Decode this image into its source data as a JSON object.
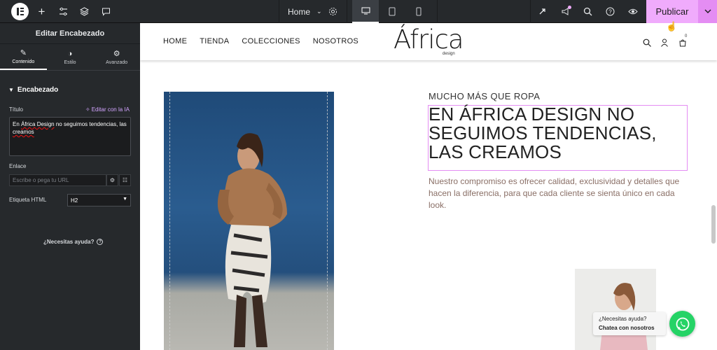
{
  "topbar": {
    "page_name": "Home",
    "publish_label": "Publicar",
    "accent": "#f0abfc"
  },
  "panel": {
    "title": "Editar Encabezado",
    "tabs": [
      "Contenido",
      "Estilo",
      "Avanzado"
    ],
    "section": "Encabezado",
    "title_label": "Título",
    "ai_link": "Editar con la IA",
    "title_value_a": "En ",
    "title_value_b": "África Design",
    "title_value_c": " no seguimos tendencias, las ",
    "title_value_d": "creamos",
    "link_label": "Enlace",
    "link_placeholder": "Escribe o pega tu URL",
    "html_tag_label": "Etiqueta HTML",
    "html_tag_value": "H2",
    "help": "¿Necesitas ayuda?"
  },
  "site": {
    "nav": [
      "HOME",
      "TIENDA",
      "COLECCIONES",
      "NOSOTROS"
    ],
    "brand": "África",
    "brand_sub": "design",
    "cart_count": "0",
    "kicker": "MUCHO MÁS QUE ROPA",
    "heading": "EN ÁFRICA DESIGN NO SEGUIMOS TENDENCIAS, LAS CREAMOS",
    "body": "Nuestro compromiso es ofrecer calidad, exclusividad y detalles que hacen la diferencia, para que cada cliente se sienta único en cada look.",
    "chat_line1": "¿Necesitas ayuda?",
    "chat_line2": "Chatea con nosotros",
    "whatsapp_color": "#25d366"
  }
}
